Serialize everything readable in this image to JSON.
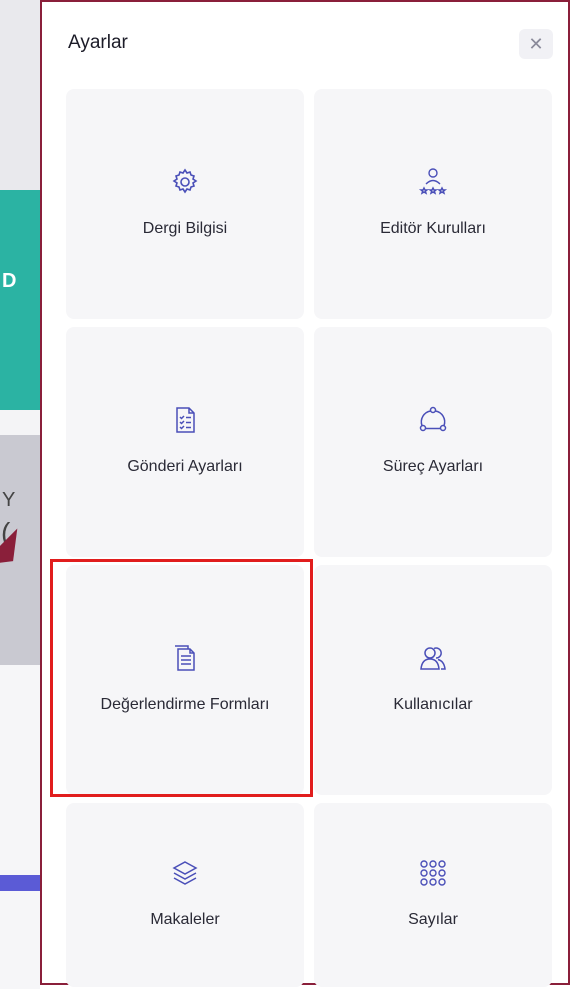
{
  "background": {
    "teal_char": "D",
    "grey_char_1": "Y",
    "grey_char_2": "("
  },
  "panel": {
    "title": "Ayarlar",
    "close_icon": "close-icon"
  },
  "tiles": [
    {
      "label": "Dergi Bilgisi",
      "icon": "gear-icon"
    },
    {
      "label": "Editör Kurulları",
      "icon": "person-stars-icon"
    },
    {
      "label": "Gönderi Ayarları",
      "icon": "checklist-document-icon"
    },
    {
      "label": "Süreç Ayarları",
      "icon": "cycle-icon"
    },
    {
      "label": "Değerlendirme Formları",
      "icon": "documents-icon"
    },
    {
      "label": "Kullanıcılar",
      "icon": "users-icon"
    },
    {
      "label": "Makaleler",
      "icon": "layers-icon"
    },
    {
      "label": "Sayılar",
      "icon": "dots-grid-icon"
    }
  ],
  "colors": {
    "accent_border": "#8a1f3a",
    "highlight": "#e11d1d",
    "icon_stroke": "#4a4fb8",
    "tile_bg": "#f6f6f8"
  }
}
